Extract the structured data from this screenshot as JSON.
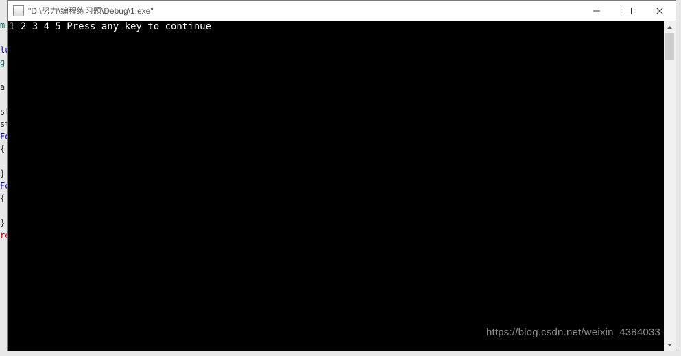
{
  "bg_fragments": [
    {
      "t": "m",
      "c": "nm"
    },
    {
      "t": "",
      "c": ""
    },
    {
      "t": "lu",
      "c": "kw"
    },
    {
      "t": "g",
      "c": "nm"
    },
    {
      "t": "",
      "c": ""
    },
    {
      "t": "a",
      "c": ""
    },
    {
      "t": "",
      "c": ""
    },
    {
      "t": "st",
      "c": ""
    },
    {
      "t": "st",
      "c": ""
    },
    {
      "t": "Fo",
      "c": "kw"
    },
    {
      "t": "{",
      "c": ""
    },
    {
      "t": "",
      "c": ""
    },
    {
      "t": "}",
      "c": ""
    },
    {
      "t": "Fo",
      "c": "kw"
    },
    {
      "t": "{",
      "c": ""
    },
    {
      "t": "",
      "c": ""
    },
    {
      "t": "}",
      "c": ""
    },
    {
      "t": "re",
      "c": "rd"
    }
  ],
  "titlebar": {
    "title": "\"D:\\努力\\编程练习题\\Debug\\1.exe\""
  },
  "console": {
    "output": "1 2 3 4 5 Press any key to continue"
  },
  "watermark": "https://blog.csdn.net/weixin_4384033"
}
